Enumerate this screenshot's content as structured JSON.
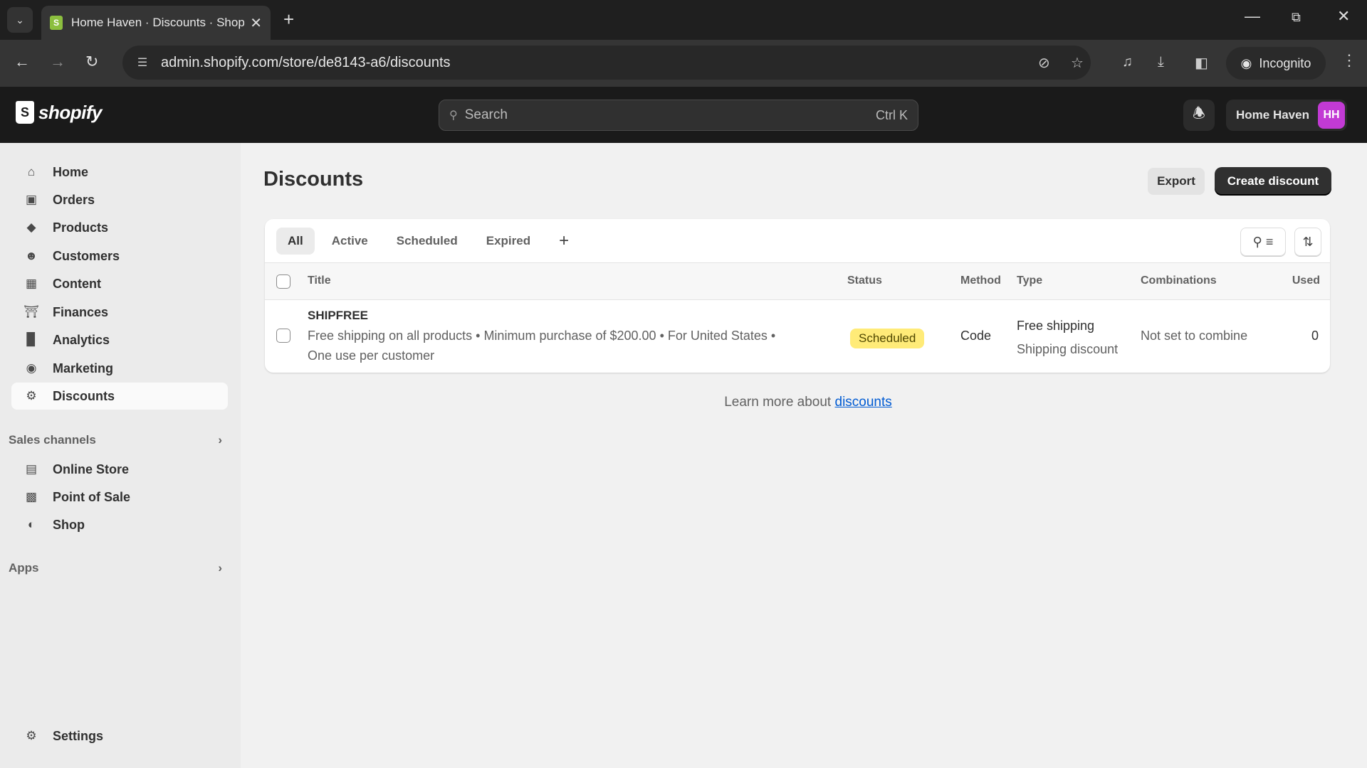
{
  "browser": {
    "tab_title": "Home Haven · Discounts · Shop",
    "url": "admin.shopify.com/store/de8143-a6/discounts",
    "incognito_label": "Incognito",
    "icons": [
      "tab-search-icon",
      "shopify-favicon",
      "close-tab-icon",
      "new-tab-icon",
      "minimize-icon",
      "restore-icon",
      "close-window-icon",
      "back-icon",
      "forward-icon",
      "reload-icon",
      "site-settings-icon",
      "eye-off-icon",
      "star-icon",
      "media-icon",
      "download-icon",
      "sidepanel-icon",
      "incognito-icon",
      "menu-icon"
    ]
  },
  "topbar": {
    "logo": "shopify",
    "search_placeholder": "Search",
    "search_shortcut": "Ctrl K",
    "store_name": "Home Haven",
    "avatar_initials": "HH",
    "avatar_color": "#c23ad4"
  },
  "sidebar": {
    "items": [
      {
        "label": "Home",
        "icon": "home-icon"
      },
      {
        "label": "Orders",
        "icon": "inbox-icon"
      },
      {
        "label": "Products",
        "icon": "tag-icon"
      },
      {
        "label": "Customers",
        "icon": "person-icon"
      },
      {
        "label": "Content",
        "icon": "image-icon"
      },
      {
        "label": "Finances",
        "icon": "bank-icon"
      },
      {
        "label": "Analytics",
        "icon": "bar-chart-icon"
      },
      {
        "label": "Marketing",
        "icon": "target-icon"
      },
      {
        "label": "Discounts",
        "icon": "discount-icon",
        "active": true
      }
    ],
    "sales_channels_label": "Sales channels",
    "channels": [
      {
        "label": "Online Store",
        "icon": "store-icon"
      },
      {
        "label": "Point of Sale",
        "icon": "pos-icon"
      },
      {
        "label": "Shop",
        "icon": "shop-icon"
      }
    ],
    "apps_label": "Apps",
    "settings_label": "Settings"
  },
  "main": {
    "title": "Discounts",
    "export_label": "Export",
    "create_label": "Create discount",
    "filter_tabs": [
      "All",
      "Active",
      "Scheduled",
      "Expired"
    ],
    "selected_tab": "All",
    "columns": [
      "Title",
      "Status",
      "Method",
      "Type",
      "Combinations",
      "Used"
    ],
    "rows": [
      {
        "code": "SHIPFREE",
        "summary_line1": "Free shipping on all products • Minimum purchase of $200.00 • For United States •",
        "summary_line2": "One use per customer",
        "status": "Scheduled",
        "method": "Code",
        "type_line1": "Free shipping",
        "type_line2": "Shipping discount",
        "combinations": "Not set to combine",
        "used": "0"
      }
    ],
    "learn_more_prefix": "Learn more about",
    "learn_more_link": "discounts",
    "status_colors": {
      "scheduled_bg": "#ffeb78",
      "scheduled_text": "#4f4700"
    },
    "accent_link": "#005bd3"
  }
}
